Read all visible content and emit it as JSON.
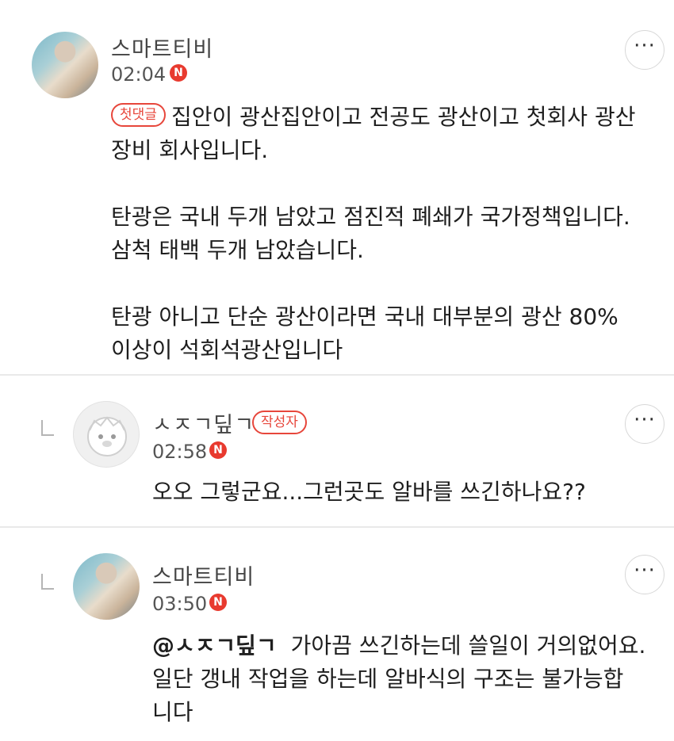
{
  "comments": [
    {
      "nickname": "스마트티비",
      "time": "02:04",
      "new_badge": "N",
      "tag": "첫댓글",
      "lines": [
        "집안이 광산집안이고 전공도 광산이고 첫회사 광산",
        "장비 회사입니다.",
        "",
        "탄광은 국내 두개 남았고 점진적 폐쇄가 국가정책입니다.",
        "삼척 태백 두개 남았습니다.",
        "",
        "탄광 아니고 단순 광산이라면 국내 대부분의 광산 80%",
        "이상이 석회석광산입니다"
      ]
    },
    {
      "nickname": "ㅅㅈㄱ딮ㄱ",
      "author_tag": "작성자",
      "time": "02:58",
      "new_badge": "N",
      "lines": [
        "오오 그렇군요...그런곳도 알바를 쓰긴하나요??"
      ]
    },
    {
      "nickname": "스마트티비",
      "time": "03:50",
      "new_badge": "N",
      "mention": "@ㅅㅈㄱ딮ㄱ",
      "lines": [
        "가아끔 쓰긴하는데 쓸일이 거의없어요.",
        "일단 갱내 작업을 하는데 알바식의 구조는 불가능합",
        "니다"
      ]
    }
  ],
  "more_label": "···",
  "colors": {
    "accent": "#e7463b",
    "divider": "#e9e9e9"
  },
  "icons": {
    "more": "more-dots-icon",
    "reply": "reply-arrow-icon",
    "new": "new-badge-icon"
  }
}
